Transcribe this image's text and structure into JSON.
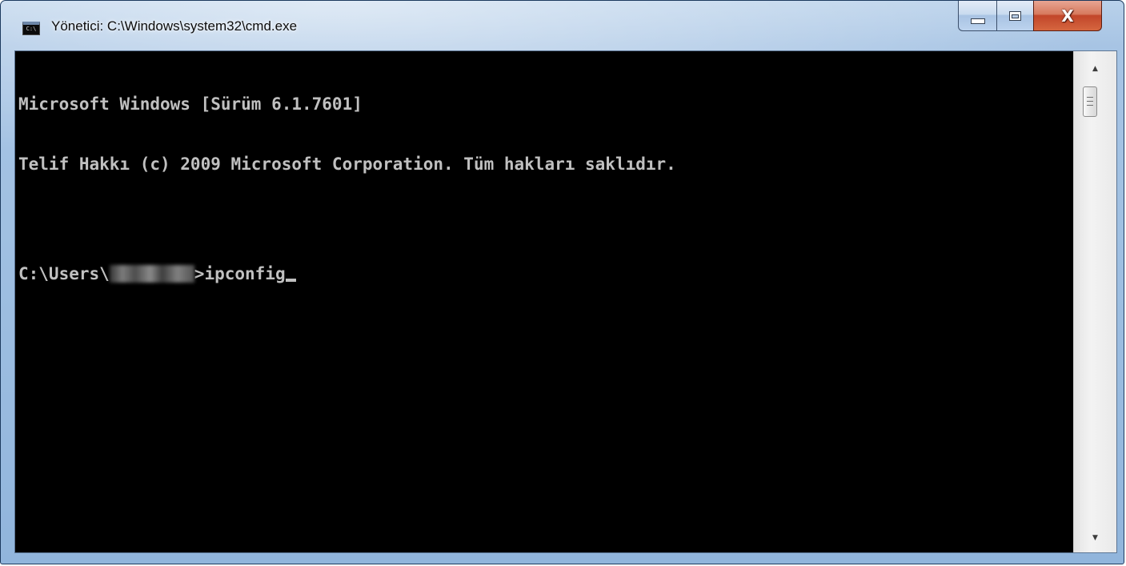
{
  "window": {
    "title": "Yönetici: C:\\Windows\\system32\\cmd.exe",
    "icon": "cmd-icon",
    "icon_text": "C:\\",
    "buttons": {
      "minimize_icon": "minimize-icon",
      "maximize_icon": "maximize-icon",
      "close_glyph": "X"
    }
  },
  "console": {
    "line1": "Microsoft Windows [Sürüm 6.1.7601]",
    "line2": "Telif Hakkı (c) 2009 Microsoft Corporation. Tüm hakları saklıdır.",
    "prompt_prefix": "C:\\Users\\",
    "prompt_suffix": ">",
    "command": "ipconfig",
    "colors": {
      "background": "#000000",
      "foreground": "#c0c0c0"
    }
  },
  "scrollbar": {
    "up_arrow": "▲",
    "down_arrow": "▼"
  }
}
